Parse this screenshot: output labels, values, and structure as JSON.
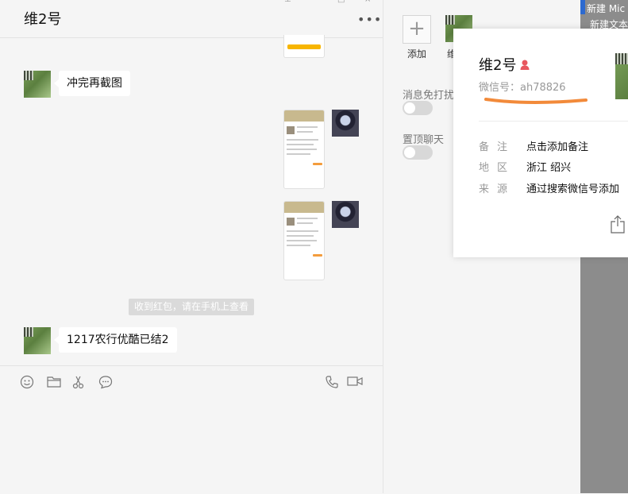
{
  "chat": {
    "title": "维2号",
    "more_icon": "•••",
    "messages": [
      {
        "side": "left",
        "type": "text",
        "text": "冲完再截图"
      },
      {
        "side": "right",
        "type": "image"
      },
      {
        "side": "right",
        "type": "image"
      },
      {
        "side": "system",
        "type": "notice",
        "text": "收到红包，请在手机上查看"
      },
      {
        "side": "left",
        "type": "text",
        "text": "1217农行优酷已结2"
      }
    ],
    "toolbar": {
      "icons": [
        "emoji-icon",
        "folder-icon",
        "scissors-icon",
        "chat-bubble-icon",
        "phone-icon",
        "video-icon"
      ]
    }
  },
  "settings": {
    "add_label": "添加",
    "member_label": "维",
    "mute_label": "消息免打扰",
    "pin_label": "置顶聊天"
  },
  "desktop": {
    "text1": "新建 Mic",
    "text2": "新建文本"
  },
  "profile_card": {
    "name": "维2号",
    "wechat_id": "微信号：ah78826",
    "fields": [
      {
        "label": "备注",
        "value": "点击添加备注"
      },
      {
        "label": "地区",
        "value": "浙江  绍兴"
      },
      {
        "label": "来源",
        "value": "通过搜索微信号添加"
      }
    ],
    "gender_color": "#e8585f",
    "scribble_color": "#f28a3a"
  }
}
